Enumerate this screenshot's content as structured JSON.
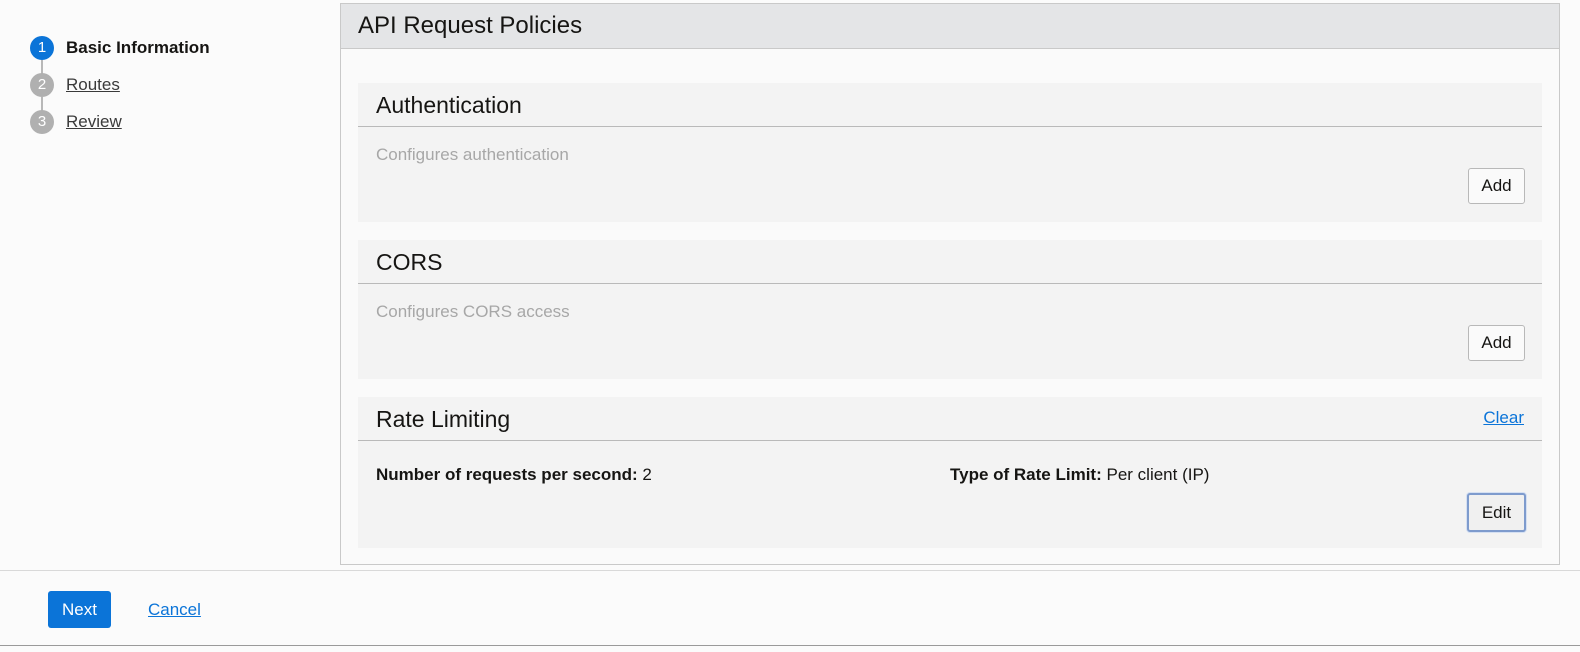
{
  "wizard": {
    "steps": [
      {
        "number": "1",
        "label": "Basic Information",
        "active": true
      },
      {
        "number": "2",
        "label": "Routes",
        "active": false
      },
      {
        "number": "3",
        "label": "Review",
        "active": false
      }
    ]
  },
  "panel": {
    "title": "API Request Policies",
    "authentication": {
      "title": "Authentication",
      "description": "Configures authentication",
      "add_label": "Add"
    },
    "cors": {
      "title": "CORS",
      "description": "Configures CORS access",
      "add_label": "Add"
    },
    "rate_limiting": {
      "title": "Rate Limiting",
      "clear_label": "Clear",
      "requests_label": "Number of requests per second:",
      "requests_value": "2",
      "type_label": "Type of Rate Limit:",
      "type_value": "Per client (IP)",
      "edit_label": "Edit"
    }
  },
  "footer": {
    "next_label": "Next",
    "cancel_label": "Cancel"
  },
  "colors": {
    "accent": "#0b74d8",
    "header_bg": "#e4e5e7",
    "section_bg": "#f3f3f3"
  }
}
